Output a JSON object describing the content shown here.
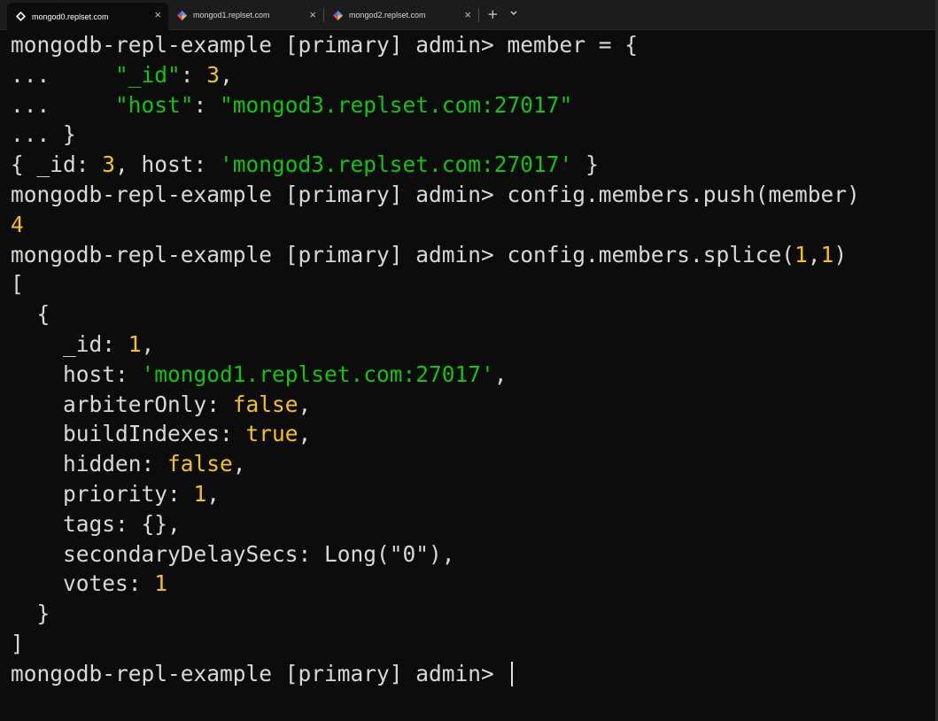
{
  "tabs": [
    {
      "label": "mongod0.replset.com",
      "active": true,
      "icon": "terminal-app-icon"
    },
    {
      "label": "mongod1.replset.com",
      "active": false,
      "icon": "terminal-app-icon"
    },
    {
      "label": "mongod2.replset.com",
      "active": false,
      "icon": "terminal-app-icon"
    }
  ],
  "tabbar": {
    "close_symbol": "×",
    "new_tab_symbol": "+"
  },
  "colors": {
    "background": "#0c0c0c",
    "text": "#d8d8d8",
    "string": "#13c30f",
    "number": "#f5c21b"
  },
  "terminal": {
    "lines": [
      [
        [
          "t",
          "mongodb-repl-example [primary] admin> member = {"
        ]
      ],
      [
        [
          "t",
          "...     "
        ],
        [
          "g",
          "\"_id\""
        ],
        [
          "t",
          ": "
        ],
        [
          "y",
          "3"
        ],
        [
          "t",
          ","
        ]
      ],
      [
        [
          "t",
          "...     "
        ],
        [
          "g",
          "\"host\""
        ],
        [
          "t",
          ": "
        ],
        [
          "g",
          "\"mongod3.replset.com:27017\""
        ]
      ],
      [
        [
          "t",
          "... }"
        ]
      ],
      [
        [
          "t",
          "{ _id: "
        ],
        [
          "y",
          "3"
        ],
        [
          "t",
          ", host: "
        ],
        [
          "g",
          "'mongod3.replset.com:27017'"
        ],
        [
          "t",
          " }"
        ]
      ],
      [
        [
          "t",
          "mongodb-repl-example [primary] admin> config.members.push(member)"
        ]
      ],
      [
        [
          "y",
          "4"
        ]
      ],
      [
        [
          "t",
          "mongodb-repl-example [primary] admin> config.members.splice("
        ],
        [
          "y",
          "1"
        ],
        [
          "t",
          ","
        ],
        [
          "y",
          "1"
        ],
        [
          "t",
          ")"
        ]
      ],
      [
        [
          "t",
          "["
        ]
      ],
      [
        [
          "t",
          "  {"
        ]
      ],
      [
        [
          "t",
          "    _id: "
        ],
        [
          "y",
          "1"
        ],
        [
          "t",
          ","
        ]
      ],
      [
        [
          "t",
          "    host: "
        ],
        [
          "g",
          "'mongod1.replset.com:27017'"
        ],
        [
          "t",
          ","
        ]
      ],
      [
        [
          "t",
          "    arbiterOnly: "
        ],
        [
          "y",
          "false"
        ],
        [
          "t",
          ","
        ]
      ],
      [
        [
          "t",
          "    buildIndexes: "
        ],
        [
          "y",
          "true"
        ],
        [
          "t",
          ","
        ]
      ],
      [
        [
          "t",
          "    hidden: "
        ],
        [
          "y",
          "false"
        ],
        [
          "t",
          ","
        ]
      ],
      [
        [
          "t",
          "    priority: "
        ],
        [
          "y",
          "1"
        ],
        [
          "t",
          ","
        ]
      ],
      [
        [
          "t",
          "    tags: {},"
        ]
      ],
      [
        [
          "t",
          "    secondaryDelaySecs: Long(\"0\"),"
        ]
      ],
      [
        [
          "t",
          "    votes: "
        ],
        [
          "y",
          "1"
        ]
      ],
      [
        [
          "t",
          "  }"
        ]
      ],
      [
        [
          "t",
          "]"
        ]
      ],
      [
        [
          "t",
          "mongodb-repl-example [primary] admin> "
        ]
      ]
    ]
  }
}
